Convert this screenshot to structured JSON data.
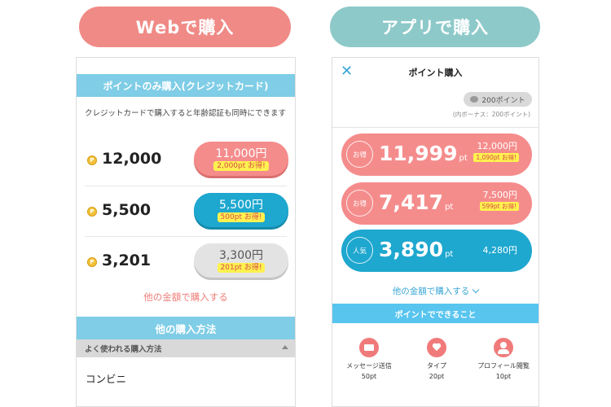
{
  "web": {
    "header": "Webで購入",
    "band_title": "ポイントのみ購入(クレジットカード)",
    "note": "クレジットカードで購入すると年齢認証も同時にできます",
    "coin_symbol": "P",
    "rows": [
      {
        "points": "12,000",
        "price": "11,000円",
        "bonus": "2,000pt お得!",
        "color": "#f58c8c"
      },
      {
        "points": "5,500",
        "price": "5,500円",
        "bonus": "500pt お得!",
        "color": "#1ea7cf"
      },
      {
        "points": "3,201",
        "price": "3,300円",
        "bonus": "201pt お得!",
        "color": "#e3e3e3"
      }
    ],
    "other_amount_link": "他の金額で購入する",
    "methods_title": "他の購入方法",
    "frequent_label": "よく使われる購入方法",
    "convenience": "コンビニ"
  },
  "app": {
    "header": "アプリで購入",
    "close_glyph": "✕",
    "title": "ポイント購入",
    "balance": "200ポイント",
    "balance_note": "(内ボーナス：200ポイント)",
    "cards": [
      {
        "badge": "お得",
        "points": "11,999",
        "unit": "pt",
        "price": "12,000円",
        "bonus": "1,090pt お得!"
      },
      {
        "badge": "お得",
        "points": "7,417",
        "unit": "pt",
        "price": "7,500円",
        "bonus": "599pt お得!"
      },
      {
        "badge": "人気",
        "points": "3,890",
        "unit": "pt",
        "price": "4,280円"
      }
    ],
    "other_amount_link": "他の金額で購入する",
    "features_title": "ポイントでできること",
    "features": [
      {
        "label": "メッセージ送信",
        "cost": "50pt",
        "icon": "mail-icon"
      },
      {
        "label": "タイプ",
        "cost": "20pt",
        "icon": "heart-icon"
      },
      {
        "label": "プロフィール閲覧",
        "cost": "10pt",
        "icon": "profile-icon"
      }
    ]
  },
  "colors": {
    "web_header": "#f08a86",
    "app_header": "#8ec9c9",
    "band_blue": "#7fcde6",
    "app_band_blue": "#58c5ef",
    "pink": "#f58c8c",
    "teal": "#1ea7cf",
    "yellow_tag": "#fff14f"
  }
}
